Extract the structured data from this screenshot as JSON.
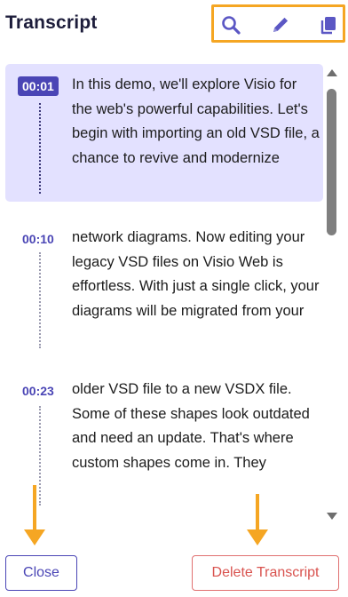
{
  "header": {
    "title": "Transcript",
    "toolbar_color": "#f5a623",
    "tools": [
      {
        "name": "search",
        "icon": "search-icon"
      },
      {
        "name": "edit",
        "icon": "pencil-icon"
      },
      {
        "name": "copy",
        "icon": "copy-icon"
      }
    ]
  },
  "transcript": {
    "entries": [
      {
        "time": "00:01",
        "text": "In this demo, we'll explore Visio for the web's powerful capabilities. Let's begin with importing an old VSD file, a chance to revive and modernize",
        "active": true
      },
      {
        "time": "00:10",
        "text": "network diagrams. Now editing your legacy VSD files on Visio Web is effortless. With just a single click, your diagrams will be migrated from your",
        "active": false
      },
      {
        "time": "00:23",
        "text": "older VSD file to a new VSDX file. Some of these shapes look outdated and need an update. That's where custom shapes come in. They",
        "active": false
      }
    ]
  },
  "footer": {
    "close_label": "Close",
    "delete_label": "Delete Transcript"
  },
  "colors": {
    "accent": "#4a45b5",
    "active_bg": "#e3e1ff",
    "danger": "#d9534f",
    "annotation": "#f5a623"
  }
}
